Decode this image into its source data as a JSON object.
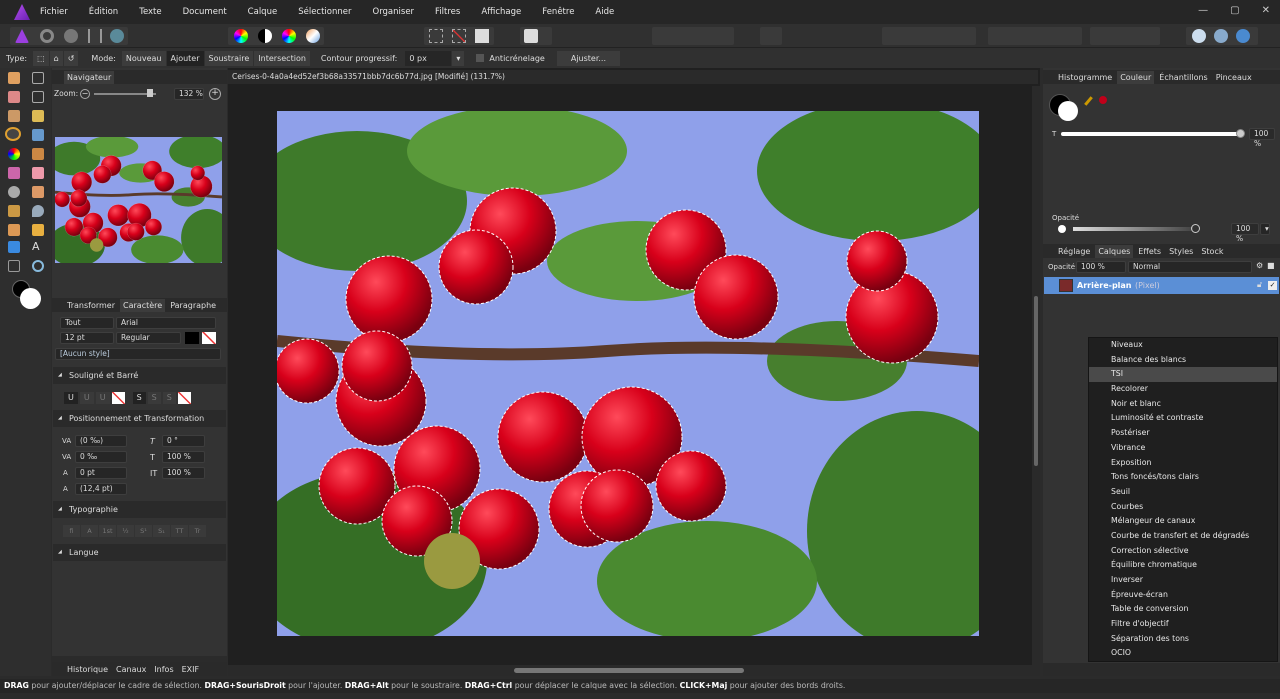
{
  "menu": [
    "Fichier",
    "Édition",
    "Texte",
    "Document",
    "Calque",
    "Sélectionner",
    "Organiser",
    "Filtres",
    "Affichage",
    "Fenêtre",
    "Aide"
  ],
  "context": {
    "type_label": "Type:",
    "mode_label": "Mode:",
    "modes": [
      "Nouveau",
      "Ajouter",
      "Soustraire",
      "Intersection"
    ],
    "active_mode": "Ajouter",
    "feather_label": "Contour progressif:",
    "feather_value": "0 px",
    "antialias_label": "Anticrénelage",
    "refine_button": "Ajuster..."
  },
  "navigator": {
    "tab": "Navigateur",
    "zoom_label": "Zoom:",
    "zoom_value": "132 %"
  },
  "text_panel": {
    "tabs": [
      "Transformer",
      "Caractère",
      "Paragraphe"
    ],
    "active_tab": "Caractère",
    "scope": "Tout",
    "font": "Arial",
    "size": "12 pt",
    "weight": "Regular",
    "style": "[Aucun style]",
    "sections": {
      "underline": "Souligné et Barré",
      "positioning": "Positionnement et Transformation",
      "typography": "Typographie",
      "language": "Langue"
    },
    "underline_buttons": [
      "U",
      "U",
      "U"
    ],
    "strike_buttons": [
      "S",
      "S",
      "S"
    ],
    "fields": {
      "kerning": "(0 ‰)",
      "tracking": "0 ‰",
      "baseline": "0 pt",
      "leading": "(12,4 pt)",
      "skew": "0 °",
      "vscale": "100 %",
      "hscale": "100 %"
    },
    "typo_buttons": [
      "fi",
      "A",
      "1st",
      "½",
      "S¹",
      "S₁",
      "TT",
      "Tr"
    ]
  },
  "bottom_tabs": [
    "Historique",
    "Canaux",
    "Infos",
    "EXIF"
  ],
  "document": {
    "title": "Cerises-0-4a0a4ed52ef3b68a33571bbb7dc6b77d.jpg [Modifié] (131.7%)"
  },
  "color_panel": {
    "tabs": [
      "Histogramme",
      "Couleur",
      "Échantillons",
      "Pinceaux"
    ],
    "active_tab": "Couleur",
    "t_label": "T",
    "t_value": "100 %",
    "opacity_label": "Opacité",
    "opacity_value": "100 %",
    "swatch_color": "#c0001a"
  },
  "layers_panel": {
    "tabs": [
      "Réglage",
      "Calques",
      "Effets",
      "Styles",
      "Stock"
    ],
    "active_tab": "Calques",
    "opacity_label": "Opacité:",
    "opacity_value": "100 %",
    "blend_mode": "Normal",
    "layer_name": "Arrière-plan",
    "layer_type": "(Pixel)"
  },
  "adjustment_menu": {
    "items": [
      "Niveaux",
      "Balance des blancs",
      "TSI",
      "Recolorer",
      "Noir et blanc",
      "Luminosité et contraste",
      "Postériser",
      "Vibrance",
      "Exposition",
      "Tons foncés/tons clairs",
      "Seuil",
      "Courbes",
      "Mélangeur de canaux",
      "Courbe de transfert et de dégradés",
      "Correction sélective",
      "Équilibre chromatique",
      "Inverser",
      "Épreuve-écran",
      "Table de conversion",
      "Filtre d'objectif",
      "Séparation des tons",
      "OCIO"
    ],
    "highlighted": "TSI"
  },
  "status": [
    [
      "DRAG",
      " pour ajouter/déplacer le cadre de sélection. "
    ],
    [
      "DRAG+SourisDroit",
      " pour l'ajouter. "
    ],
    [
      "DRAG+Alt",
      " pour le soustraire. "
    ],
    [
      "DRAG+Ctrl",
      " pour déplacer le calque avec la sélection. "
    ],
    [
      "CLICK+Maj",
      " pour ajouter des bords droits."
    ]
  ],
  "colors": {
    "accent": "#5b8fd6",
    "bg": "#2b2b2b"
  }
}
